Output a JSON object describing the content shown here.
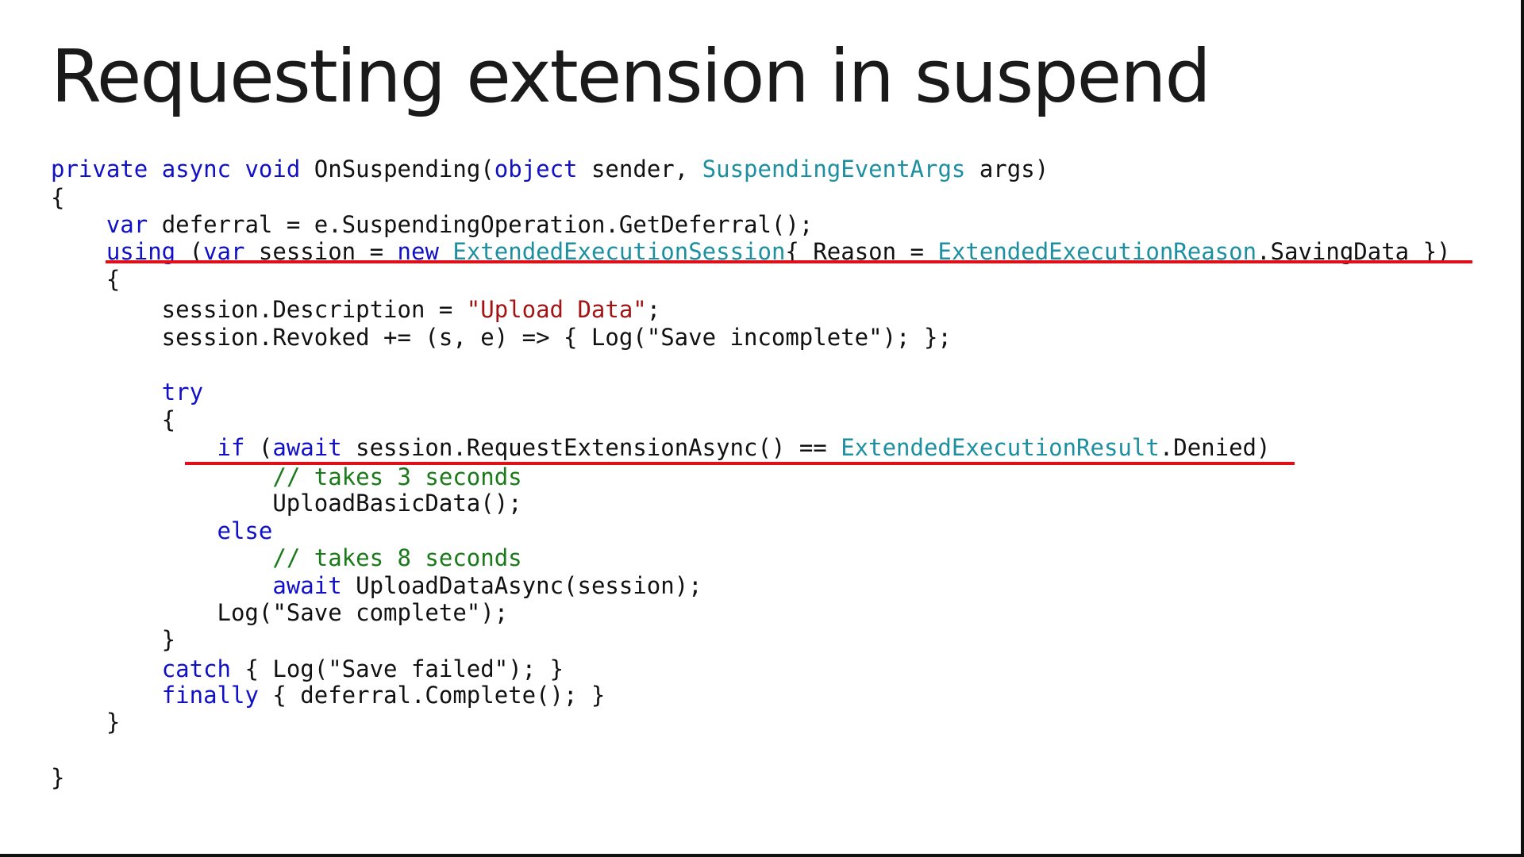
{
  "slide": {
    "title": "Requesting extension in suspend"
  },
  "code": {
    "lines": [
      [
        {
          "t": "private",
          "c": "kw"
        },
        {
          "t": " "
        },
        {
          "t": "async",
          "c": "kw"
        },
        {
          "t": " "
        },
        {
          "t": "void",
          "c": "kw"
        },
        {
          "t": " OnSuspending("
        },
        {
          "t": "object",
          "c": "kw"
        },
        {
          "t": " sender, "
        },
        {
          "t": "SuspendingEventArgs",
          "c": "type"
        },
        {
          "t": " args)"
        }
      ],
      [
        {
          "t": "{"
        }
      ],
      [
        {
          "t": "    "
        },
        {
          "t": "var",
          "c": "kw"
        },
        {
          "t": " deferral = e.SuspendingOperation.GetDeferral();"
        }
      ],
      [
        {
          "t": "    "
        },
        {
          "t": "using",
          "c": "kw"
        },
        {
          "t": " ("
        },
        {
          "t": "var",
          "c": "kw"
        },
        {
          "t": " session = "
        },
        {
          "t": "new",
          "c": "kw"
        },
        {
          "t": " "
        },
        {
          "t": "ExtendedExecutionSession",
          "c": "type"
        },
        {
          "t": "{ Reason = "
        },
        {
          "t": "ExtendedExecutionReason",
          "c": "type"
        },
        {
          "t": ".SavingData })"
        }
      ],
      [
        {
          "t": "    {"
        }
      ],
      [
        {
          "t": "        session.Description = "
        },
        {
          "t": "\"Upload Data\"",
          "c": "str"
        },
        {
          "t": ";"
        }
      ],
      [
        {
          "t": "        session.Revoked += (s, e) => { Log(\"Save incomplete\"); };"
        }
      ],
      [
        {
          "t": ""
        }
      ],
      [
        {
          "t": "        "
        },
        {
          "t": "try",
          "c": "kw"
        }
      ],
      [
        {
          "t": "        {"
        }
      ],
      [
        {
          "t": "            "
        },
        {
          "t": "if",
          "c": "kw"
        },
        {
          "t": " ("
        },
        {
          "t": "await",
          "c": "kw"
        },
        {
          "t": " session.RequestExtensionAsync() == "
        },
        {
          "t": "ExtendedExecutionResult",
          "c": "type"
        },
        {
          "t": ".Denied)"
        }
      ],
      [
        {
          "t": "                "
        },
        {
          "t": "// takes 3 seconds",
          "c": "cm"
        }
      ],
      [
        {
          "t": "                UploadBasicData();"
        }
      ],
      [
        {
          "t": "            "
        },
        {
          "t": "else",
          "c": "kw"
        }
      ],
      [
        {
          "t": "                "
        },
        {
          "t": "// takes 8 seconds",
          "c": "cm"
        }
      ],
      [
        {
          "t": "                "
        },
        {
          "t": "await",
          "c": "kw"
        },
        {
          "t": " UploadDataAsync(session);"
        }
      ],
      [
        {
          "t": "            Log(\"Save complete\");"
        }
      ],
      [
        {
          "t": "        }"
        }
      ],
      [
        {
          "t": "        "
        },
        {
          "t": "catch",
          "c": "kw"
        },
        {
          "t": " { Log(\"Save failed\"); }"
        }
      ],
      [
        {
          "t": "        "
        },
        {
          "t": "finally",
          "c": "kw"
        },
        {
          "t": " { deferral.Complete(); }"
        }
      ],
      [
        {
          "t": "    }"
        }
      ],
      [
        {
          "t": ""
        }
      ],
      [
        {
          "t": "}"
        }
      ]
    ]
  },
  "colors": {
    "keyword": "#1010c8",
    "type": "#1c8fa0",
    "string": "#a31515",
    "comment": "#1a7a1a",
    "highlight_underline": "#e0101a"
  }
}
